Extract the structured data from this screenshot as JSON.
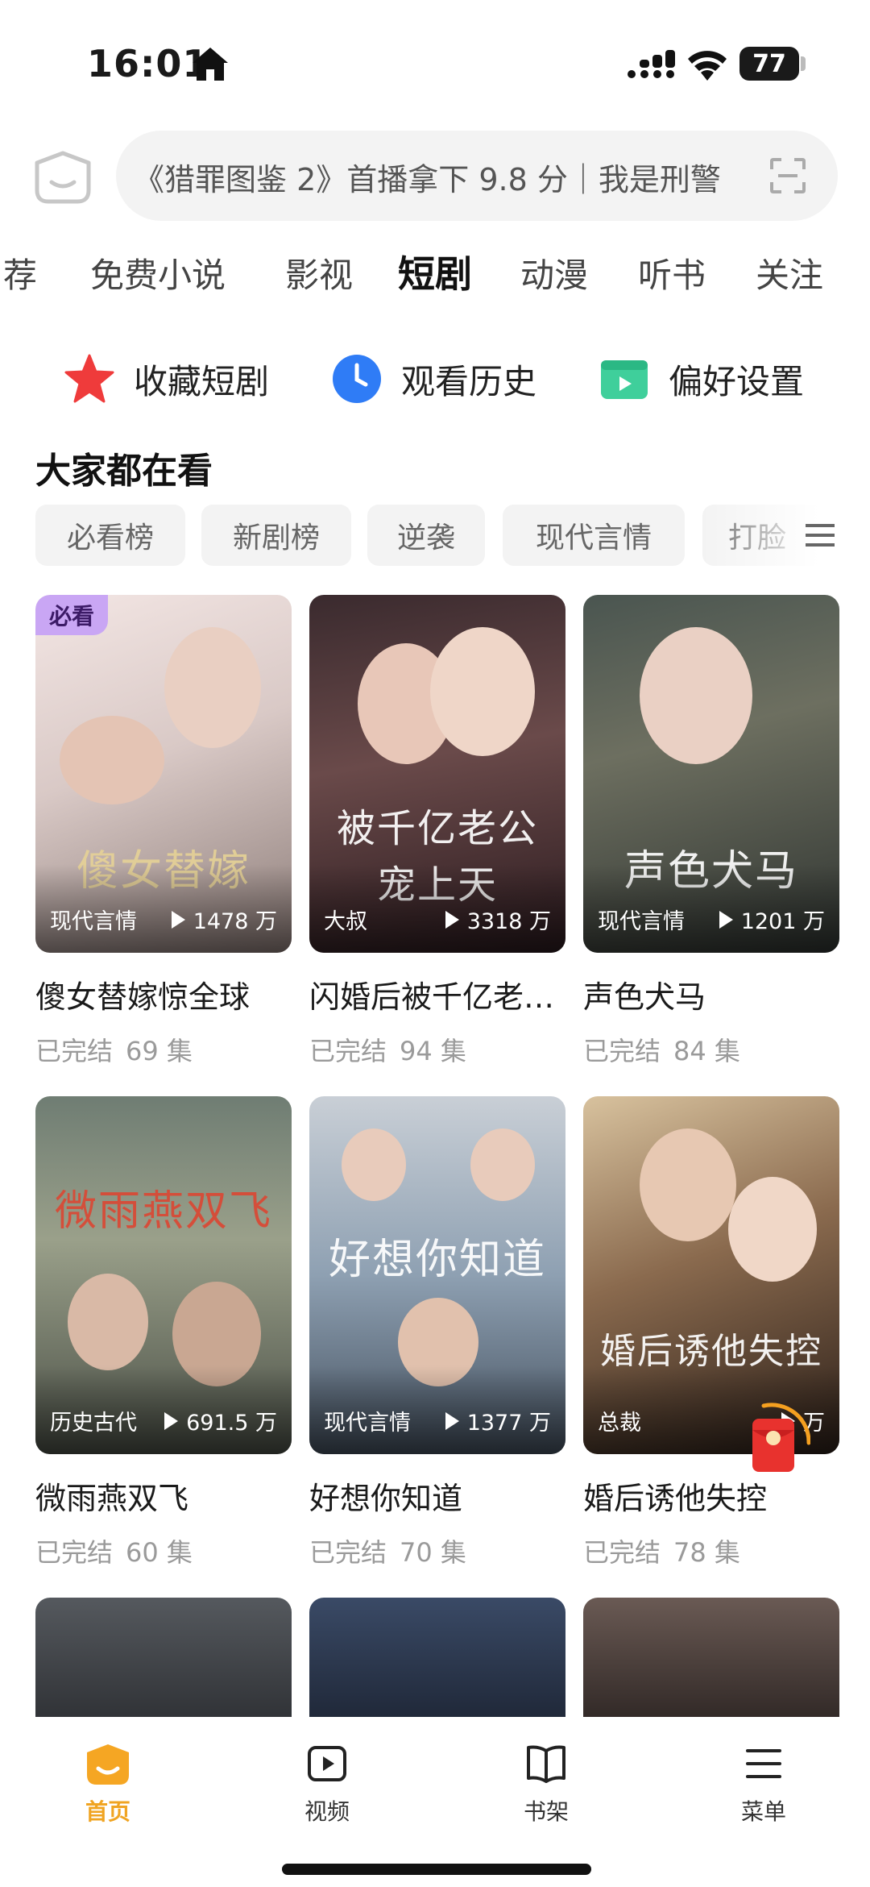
{
  "status_bar": {
    "time": "16:01",
    "battery": "77"
  },
  "search": {
    "placeholder_text": "《猎罪图鉴 2》首播拿下 9.8 分｜我是刑警"
  },
  "tabs": [
    "荐",
    "免费小说",
    "影视",
    "短剧",
    "动漫",
    "听书",
    "关注"
  ],
  "active_tab": "短剧",
  "quick_links": [
    {
      "label": "收藏短剧",
      "icon": "star-icon"
    },
    {
      "label": "观看历史",
      "icon": "clock-icon"
    },
    {
      "label": "偏好设置",
      "icon": "folder-play-icon"
    }
  ],
  "section": {
    "title": "大家都在看",
    "chips": [
      "必看榜",
      "新剧榜",
      "逆袭",
      "现代言情",
      "打脸"
    ]
  },
  "dramas": [
    {
      "title": "傻女替嫁惊全球",
      "genre": "现代言情",
      "plays": "1478 万",
      "status": "已完结",
      "episodes": "69 集",
      "badge": "必看",
      "poster_text": "傻女替嫁"
    },
    {
      "title": "闪婚后被千亿老…",
      "genre": "大叔",
      "plays": "3318 万",
      "status": "已完结",
      "episodes": "94 集",
      "poster_text": "被千亿老公宠上天"
    },
    {
      "title": "声色犬马",
      "genre": "现代言情",
      "plays": "1201 万",
      "status": "已完结",
      "episodes": "84 集",
      "poster_text": "声色犬马"
    },
    {
      "title": "微雨燕双飞",
      "genre": "历史古代",
      "plays": "691.5 万",
      "status": "已完结",
      "episodes": "60 集",
      "poster_text": "微雨燕双飞"
    },
    {
      "title": "好想你知道",
      "genre": "现代言情",
      "plays": "1377 万",
      "status": "已完结",
      "episodes": "70 集",
      "poster_text": "好想你知道"
    },
    {
      "title": "婚后诱他失控",
      "genre": "总裁",
      "plays": "万",
      "status": "已完结",
      "episodes": "78 集",
      "poster_text": "婚后诱他失控"
    }
  ],
  "bottom_nav": [
    {
      "label": "首页",
      "icon": "home-icon",
      "active": true
    },
    {
      "label": "视频",
      "icon": "video-icon",
      "active": false
    },
    {
      "label": "书架",
      "icon": "book-icon",
      "active": false
    },
    {
      "label": "菜单",
      "icon": "menu-icon",
      "active": false
    }
  ],
  "colors": {
    "accent": "#f0a422",
    "badge_bg": "#c9a6f4",
    "chip_bg": "#f3f3f3"
  }
}
